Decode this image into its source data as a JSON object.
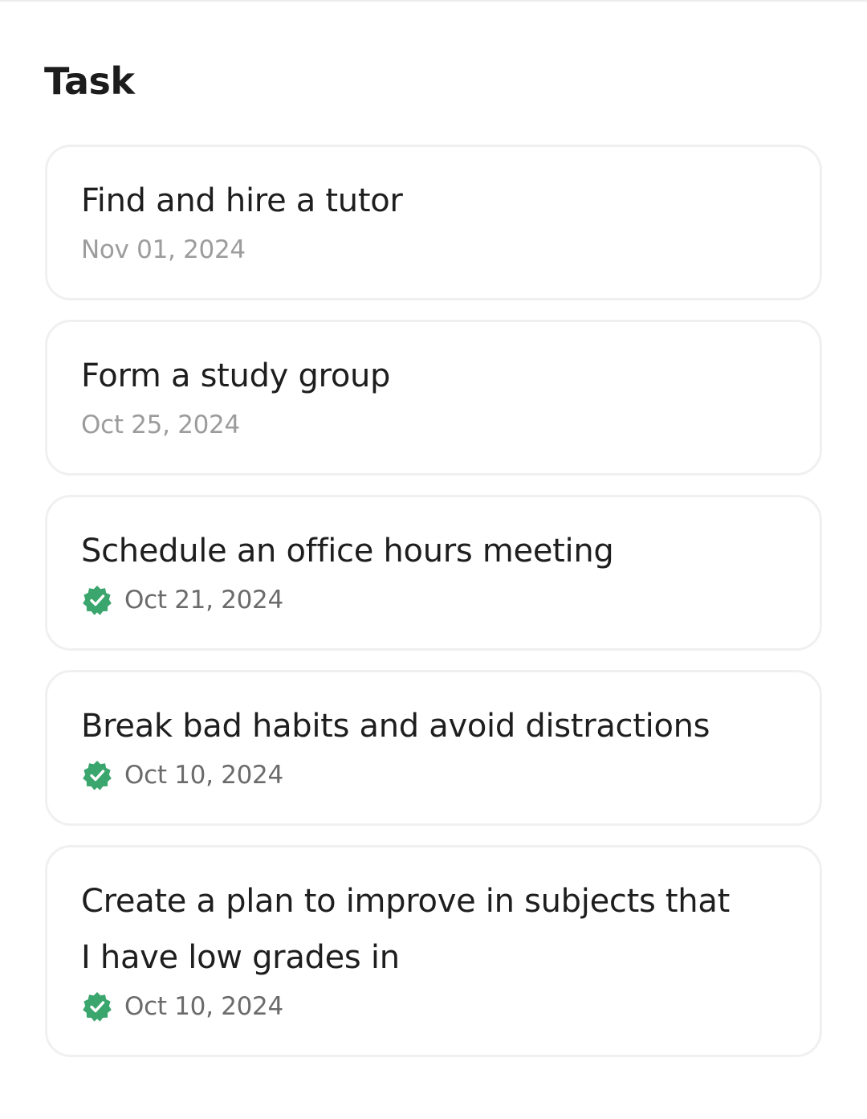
{
  "section": {
    "title": "Task"
  },
  "colors": {
    "check": "#3aa56c",
    "pending_date": "#9c9c9c",
    "done_date": "#6b6b6b"
  },
  "tasks": [
    {
      "title": "Find and hire a tutor",
      "date": "Nov 01, 2024",
      "completed": false,
      "icon": "none"
    },
    {
      "title": "Form a study group",
      "date": "Oct 25, 2024",
      "completed": false,
      "icon": "none"
    },
    {
      "title": "Schedule an office hours meeting",
      "date": "Oct 21, 2024",
      "completed": true,
      "icon": "verified-check-icon"
    },
    {
      "title": "Break bad habits and avoid distractions",
      "date": "Oct 10, 2024",
      "completed": true,
      "icon": "verified-check-icon"
    },
    {
      "title": "Create a plan to improve in subjects that I have low grades in",
      "date": "Oct 10, 2024",
      "completed": true,
      "icon": "verified-check-icon"
    }
  ]
}
